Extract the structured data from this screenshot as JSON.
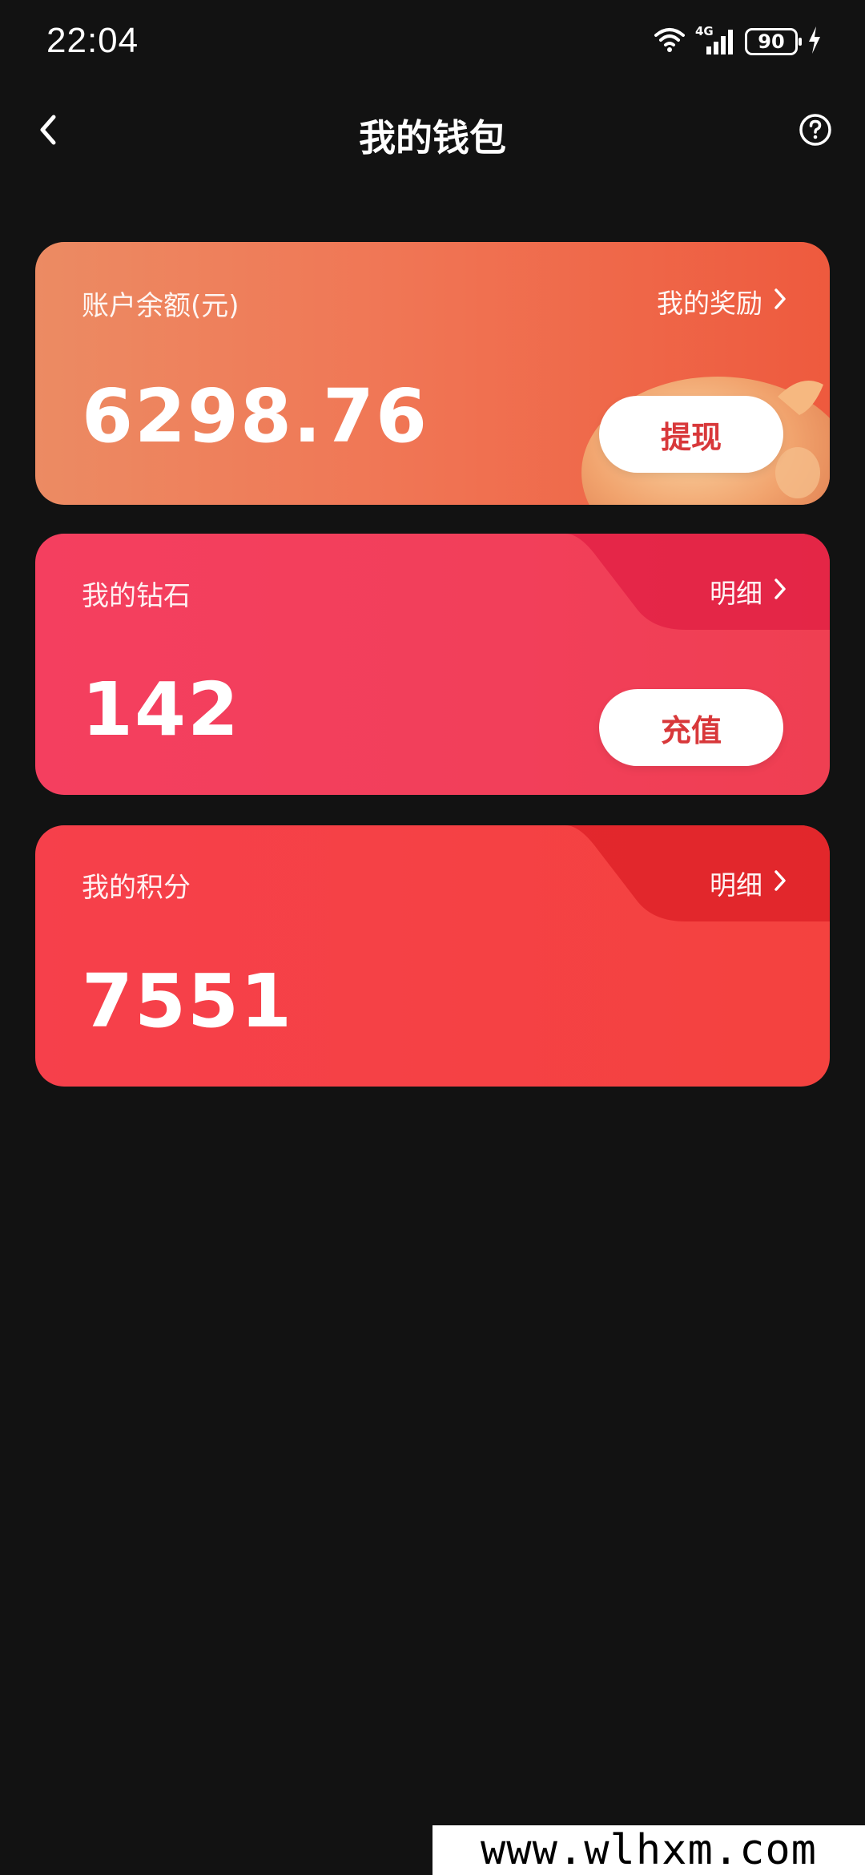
{
  "status_bar": {
    "time": "22:04",
    "network": "4G",
    "battery": "90",
    "icons": [
      "wifi-icon",
      "signal-icon",
      "battery-icon",
      "charging-icon"
    ]
  },
  "header": {
    "title": "我的钱包",
    "back_icon": "chevron-left-icon",
    "help_icon": "question-circle-icon"
  },
  "cards": {
    "balance": {
      "label": "账户余额(元)",
      "link": "我的奖励",
      "value": "6298.76",
      "button": "提现"
    },
    "diamond": {
      "label": "我的钻石",
      "link": "明细",
      "value": "142",
      "button": "充值"
    },
    "points": {
      "label": "我的积分",
      "link": "明细",
      "value": "7551"
    }
  },
  "watermark": "www.wlhxm.com",
  "colors": {
    "background": "#121212",
    "balance_card": "#f07655",
    "diamond_card": "#f23f5a",
    "points_card": "#f4423f",
    "button_text": "#d8383a"
  }
}
